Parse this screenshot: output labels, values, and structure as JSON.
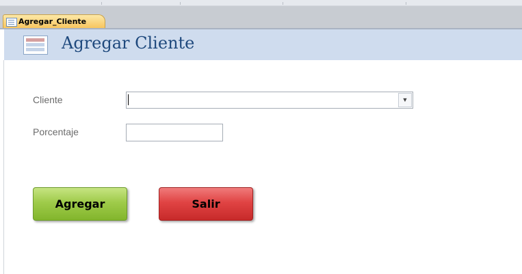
{
  "tab": {
    "label": "Agregar_Cliente"
  },
  "form": {
    "title": "Agregar Cliente",
    "fields": {
      "cliente": {
        "label": "Cliente",
        "value": ""
      },
      "porcentaje": {
        "label": "Porcentaje",
        "value": ""
      }
    }
  },
  "buttons": {
    "agregar": "Agregar",
    "salir": "Salir"
  },
  "icons": {
    "tab_icon": "form-icon",
    "header_icon": "form-icon",
    "dropdown_icon": "chevron-down-icon"
  },
  "colors": {
    "header_bg": "#cfdcee",
    "title": "#1f497d",
    "tab_active": "#f7c35a",
    "agregar_button": "#9fcb4a",
    "salir_button": "#e04343"
  }
}
